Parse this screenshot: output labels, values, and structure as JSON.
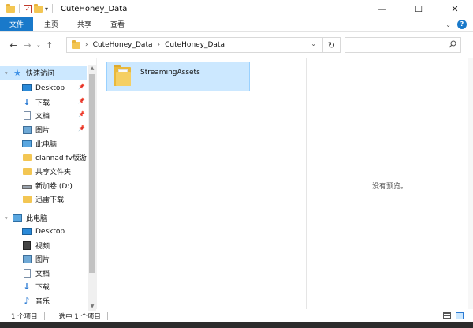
{
  "window": {
    "title": "CuteHoney_Data",
    "controls": {
      "minimize": "—",
      "maximize": "☐",
      "close": "✕"
    }
  },
  "ribbon": {
    "tabs": [
      "文件",
      "主页",
      "共享",
      "查看"
    ]
  },
  "address": {
    "breadcrumbs": [
      "CuteHoney_Data",
      "CuteHoney_Data"
    ],
    "search_placeholder": ""
  },
  "sidebar": {
    "quick_access_label": "快速访问",
    "quick_items": [
      {
        "label": "Desktop",
        "icon": "desktop-icon",
        "pinned": true
      },
      {
        "label": "下载",
        "icon": "download-icon",
        "pinned": true
      },
      {
        "label": "文档",
        "icon": "document-icon",
        "pinned": true
      },
      {
        "label": "图片",
        "icon": "pictures-icon",
        "pinned": true
      },
      {
        "label": "此电脑",
        "icon": "computer-icon",
        "pinned": false
      },
      {
        "label": "clannad fv版游戏",
        "icon": "folder-icon",
        "pinned": false
      },
      {
        "label": "共享文件夹",
        "icon": "folder-icon",
        "pinned": false
      },
      {
        "label": "新加卷 (D:)",
        "icon": "drive-icon",
        "pinned": false
      },
      {
        "label": "迅雷下载",
        "icon": "folder-icon",
        "pinned": false
      }
    ],
    "this_pc_label": "此电脑",
    "pc_items": [
      {
        "label": "Desktop",
        "icon": "desktop-icon"
      },
      {
        "label": "视频",
        "icon": "video-icon"
      },
      {
        "label": "图片",
        "icon": "pictures-icon"
      },
      {
        "label": "文档",
        "icon": "document-icon"
      },
      {
        "label": "下载",
        "icon": "download-icon"
      },
      {
        "label": "音乐",
        "icon": "music-icon"
      }
    ]
  },
  "content": {
    "items": [
      {
        "name": "StreamingAssets",
        "type": "folder",
        "selected": true
      }
    ],
    "preview_text": "没有预览。"
  },
  "status": {
    "item_count": "1 个项目",
    "selected_count": "选中 1 个项目"
  },
  "colors": {
    "accent": "#1979ca",
    "selection": "#cce8ff",
    "selection_border": "#99d1ff",
    "folder": "#f3c653"
  }
}
